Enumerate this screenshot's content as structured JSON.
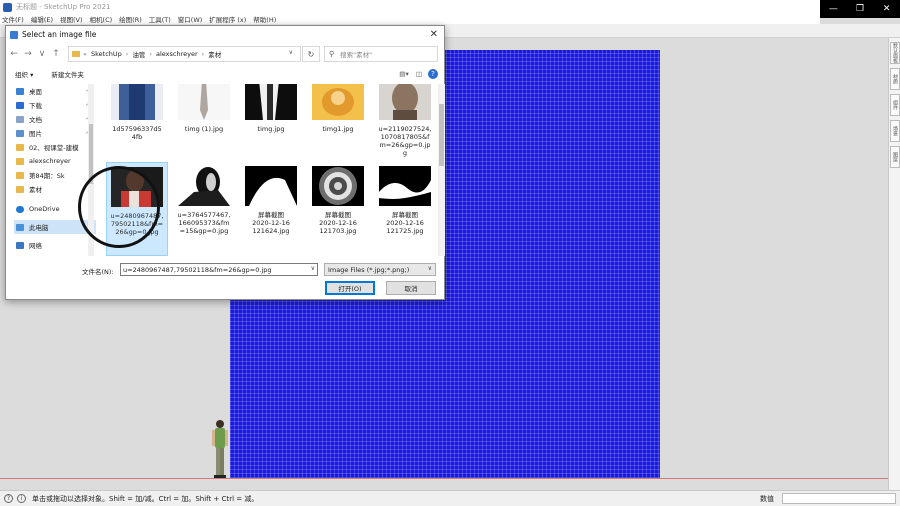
{
  "app": {
    "title": "无标题 - SketchUp Pro 2021",
    "window_controls": [
      "—",
      "❐",
      "✕"
    ],
    "menu": [
      "文件(F)",
      "编辑(E)",
      "视图(V)",
      "相机(C)",
      "绘图(R)",
      "工具(T)",
      "窗口(W)",
      "扩展程序 (x)",
      "帮助(H)"
    ]
  },
  "right_panel": [
    "默认面板",
    "材质",
    "组件",
    "场景",
    "图层"
  ],
  "status": {
    "text": "单击或拖动以选择对象。Shift = 加/减。Ctrl = 加。Shift + Ctrl = 减。",
    "measure_label": "数值",
    "measure_value": ""
  },
  "dialog": {
    "title": "Select an image file",
    "close": "✕",
    "nav_buttons": [
      "←",
      "→",
      "∨",
      "↑"
    ],
    "path": [
      "SketchUp",
      "油管",
      "alexschreyer",
      "素材"
    ],
    "path_prefix": "«",
    "search_placeholder": "搜索\"素材\"",
    "organize": "组织 ▾",
    "new_folder": "新建文件夹",
    "nav_items": [
      {
        "label": "桌面",
        "pinned": true
      },
      {
        "label": "下载",
        "pinned": true
      },
      {
        "label": "文档",
        "pinned": true
      },
      {
        "label": "图片",
        "pinned": true
      },
      {
        "label": "02、视课堂-建模",
        "pinned": false
      },
      {
        "label": "alexschreyer",
        "pinned": false
      },
      {
        "label": "第84期：Sk",
        "pinned": false
      },
      {
        "label": "素材",
        "pinned": false
      },
      {
        "label": "OneDrive",
        "pinned": false
      },
      {
        "label": "此电脑",
        "pinned": false,
        "selected": true
      },
      {
        "label": "网络",
        "pinned": false
      }
    ],
    "files": [
      {
        "label": "1d57596337d5\n4fb",
        "selected": false
      },
      {
        "label": "timg (1).jpg",
        "selected": false
      },
      {
        "label": "timg.jpg",
        "selected": false
      },
      {
        "label": "timg1.jpg",
        "selected": false
      },
      {
        "label": "u=2119027524,\n1070817805&f\nm=26&gp=0.jp\ng",
        "selected": false
      },
      {
        "label": "u=2480967487,\n79502118&fm=\n26&gp=0.jpg",
        "selected": true
      },
      {
        "label": "u=3764577467,\n166095373&fm\n=15&gp=0.jpg",
        "selected": false
      },
      {
        "label": "屏幕截图\n2020-12-16\n121624.jpg",
        "selected": false
      },
      {
        "label": "屏幕截图\n2020-12-16\n121703.jpg",
        "selected": false
      },
      {
        "label": "屏幕截图\n2020-12-16\n121725.jpg",
        "selected": false
      }
    ],
    "filename_label": "文件名(N):",
    "filename_value": "u=2480967487,79502118&fm=26&gp=0.jpg",
    "filetype": "Image Files (*.jpg;*.png;)",
    "open_button": "打开(O)",
    "cancel_button": "取消"
  },
  "colors": {
    "blue_plane": "#1a1ae0",
    "selection": "#cce8ff",
    "accent": "#0078d7"
  }
}
